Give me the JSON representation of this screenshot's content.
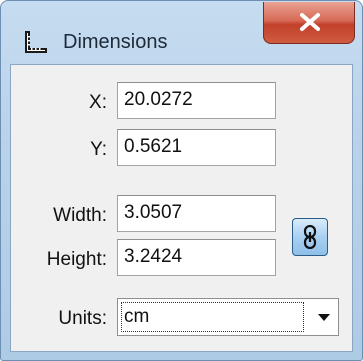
{
  "window": {
    "title": "Dimensions",
    "title_icon": "dimensions-ruler-icon",
    "close_icon": "close-x-icon"
  },
  "form": {
    "x_label": "X:",
    "x_value": "20.0272",
    "y_label": "Y:",
    "y_value": "0.5621",
    "width_label": "Width:",
    "width_value": "3.0507",
    "height_label": "Height:",
    "height_value": "3.2424",
    "link_icon": "chain-link-icon",
    "units_label": "Units:",
    "units_value": "cm"
  },
  "colors": {
    "frame": "#b9d2ea",
    "client": "#f0f0f0",
    "close": "#c2402b"
  }
}
